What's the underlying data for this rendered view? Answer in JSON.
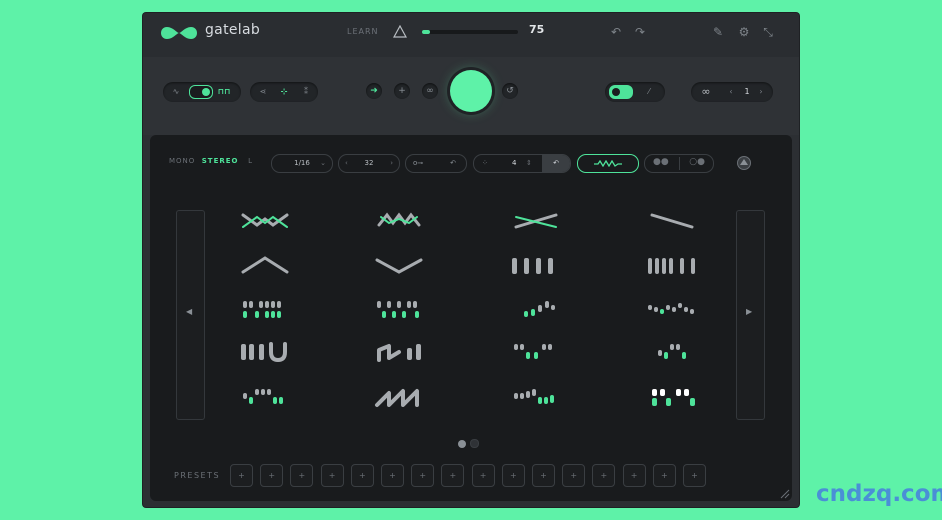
{
  "header": {
    "brand": "gatelab",
    "learn_label": "LEARN",
    "main_value": "75",
    "main_fraction": 0.08
  },
  "controls": {
    "shuffle_value": "1"
  },
  "panel": {
    "mode_mono": "MONO",
    "mode_stereo": "STEREO",
    "mode_l": "L",
    "rate": "1/16",
    "steps": "32",
    "pattern_count": "4"
  },
  "presets": {
    "label": "PRESETS",
    "count": 16,
    "slot_label": "+"
  },
  "watermark": "cndzq.com",
  "colors": {
    "accent": "#4ee39a",
    "background": "#5ef2a8",
    "panel": "#191b1d"
  }
}
